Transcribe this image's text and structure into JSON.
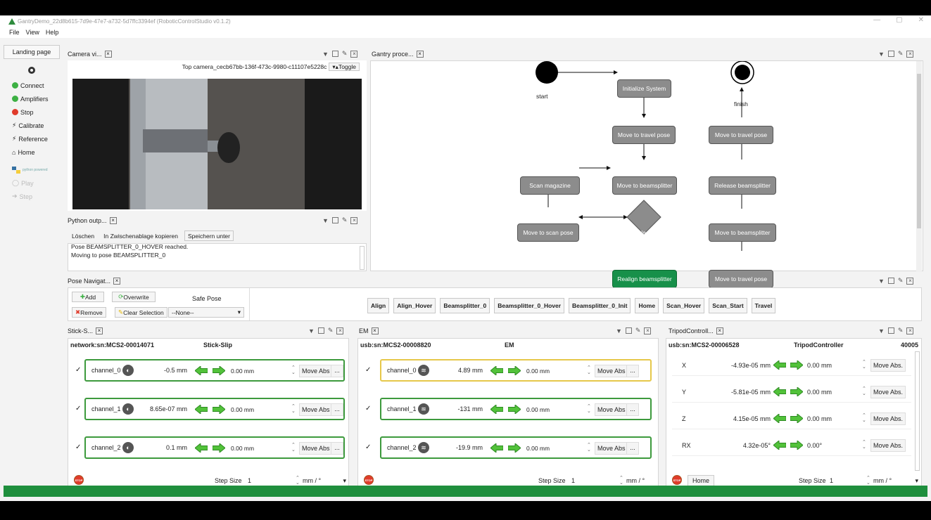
{
  "window": {
    "title": "GantryDemo_22d8b615-7d9e-47e7-a732-5d7ffc3394ef (RoboticControlStudio v0.1.2)",
    "controls": [
      "—",
      "▢",
      "✕"
    ]
  },
  "menu": [
    "File",
    "View",
    "Help"
  ],
  "sidebar": {
    "landing": "Landing page",
    "items": [
      {
        "label": "Connect",
        "color": "#3cb043",
        "kind": "dot"
      },
      {
        "label": "Amplifiers",
        "color": "#3cb043",
        "kind": "dot"
      },
      {
        "label": "Stop",
        "color": "#e03b2b",
        "kind": "stop"
      },
      {
        "label": "Calibrate",
        "kind": "sym",
        "sym": "⚡"
      },
      {
        "label": "Reference",
        "kind": "sym",
        "sym": "⚡"
      },
      {
        "label": "Home",
        "kind": "sym",
        "sym": "⌂"
      }
    ],
    "python": "python powered",
    "play": "Play",
    "step": "Step"
  },
  "camera": {
    "tab": "Camera vi...",
    "source": "Top camera_cecb67bb-136f-473c-9980-c11107e5228c",
    "toggle": "Toggle"
  },
  "gantry": {
    "tab": "Gantry proce...",
    "start": "start",
    "finish": "finish",
    "nodes": {
      "init": "Initialize System",
      "travel1": "Move to travel pose",
      "beam1": "Move to beamsplitter",
      "scanmag": "Scan magazine",
      "scanpose": "Move to scan pose",
      "select": "Select?",
      "realign": "Realign beamsplitter",
      "travel2": "Move to travel pose",
      "release": "Release beamsplitter",
      "beam2": "Move to beamsplitter",
      "travel3": "Move to travel pose"
    }
  },
  "python": {
    "tab": "Python outp...",
    "buttons": [
      "Löschen",
      "In Zwischenablage kopieren",
      "Speichern unter"
    ],
    "lines": [
      "Pose BEAMSPLITTER_0_HOVER reached.",
      "Moving to pose BEAMSPLITTER_0"
    ]
  },
  "pose": {
    "tab": "Pose Navigat...",
    "add": "Add",
    "overwrite": "Overwrite",
    "safe_label": "Safe Pose",
    "remove": "Remove",
    "clear": "Clear Selection",
    "safe_value": "--None--",
    "poses": [
      "Align",
      "Align_Hover",
      "Beamsplitter_0",
      "Beamsplitter_0_Hover",
      "Beamsplitter_0_Init",
      "Home",
      "Scan_Hover",
      "Scan_Start",
      "Travel"
    ]
  },
  "stickslip": {
    "tab": "Stick-S...",
    "device": "network:sn:MCS2-00014071",
    "type": "Stick-Slip",
    "channels": [
      {
        "name": "channel_0",
        "pos": "-0.5 mm",
        "target": "0.00 mm",
        "btn": "Move Abs"
      },
      {
        "name": "channel_1",
        "pos": "8.65e-07 mm",
        "target": "0.00 mm",
        "btn": "Move Abs"
      },
      {
        "name": "channel_2",
        "pos": "0.1 mm",
        "target": "0.00 mm",
        "btn": "Move Abs"
      }
    ],
    "step_label": "Step Size",
    "step": "1",
    "unit": "mm / °",
    "more": "..."
  },
  "em": {
    "tab": "EM",
    "device": "usb:sn:MCS2-00008820",
    "type": "EM",
    "channels": [
      {
        "name": "channel_0",
        "pos": "4.89 mm",
        "target": "0.00 mm",
        "btn": "Move Abs"
      },
      {
        "name": "channel_1",
        "pos": "-131 mm",
        "target": "0.00 mm",
        "btn": "Move Abs"
      },
      {
        "name": "channel_2",
        "pos": "-19.9 mm",
        "target": "0.00 mm",
        "btn": "Move Abs"
      }
    ],
    "step_label": "Step Size",
    "step": "1",
    "unit": "mm / °"
  },
  "tripod": {
    "tab": "TripodControll...",
    "device": "usb:sn:MCS2-00006528",
    "type": "TripodController",
    "port": "40005",
    "axes": [
      {
        "name": "X",
        "pos": "-4.93e-05 mm",
        "target": "0.00 mm",
        "btn": "Move Abs."
      },
      {
        "name": "Y",
        "pos": "-5.81e-05 mm",
        "target": "0.00 mm",
        "btn": "Move Abs."
      },
      {
        "name": "Z",
        "pos": "4.15e-05 mm",
        "target": "0.00 mm",
        "btn": "Move Abs."
      },
      {
        "name": "RX",
        "pos": "4.32e-05°",
        "target": "0.00°",
        "btn": "Move Abs."
      }
    ],
    "home": "Home",
    "step_label": "Step Size",
    "step": "1",
    "unit": "mm / °"
  },
  "colors": {
    "green": "#3cb043",
    "accent": "#1f8f3d",
    "yellow": "#e6c84a",
    "node": "#8c8c8c",
    "stop": "#e03b2b"
  }
}
